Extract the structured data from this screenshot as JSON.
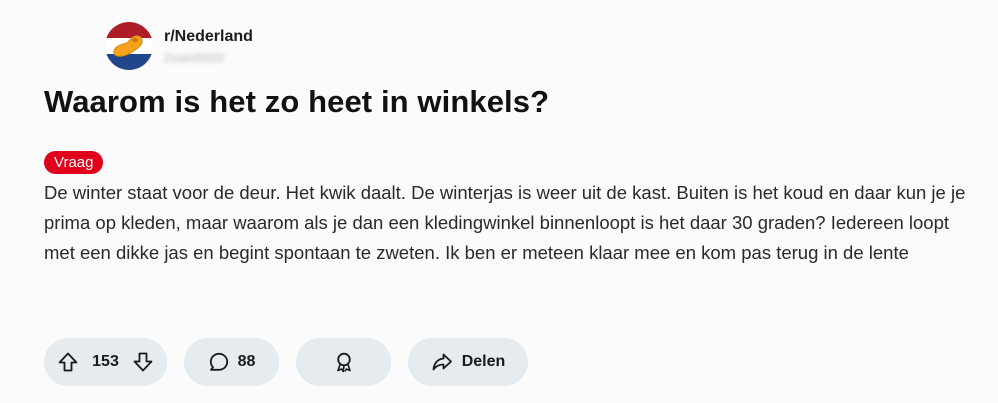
{
  "subreddit": {
    "name": "r/Nederland",
    "username": "Zealot5920",
    "flag_colors": {
      "top": "#ae1c28",
      "middle": "#ffffff",
      "bottom": "#21468b",
      "accent": "#f7a21b"
    }
  },
  "post": {
    "title": "Waarom is het zo heet in winkels?",
    "flair": {
      "label": "Vraag",
      "color": "#e0001b"
    },
    "body": "De winter staat voor de deur. Het kwik daalt. De winterjas is weer uit de kast. Buiten is het koud en daar kun je je prima op kleden, maar waarom als je dan een kledingwinkel binnenloopt is het daar 30 graden? Iedereen loopt met een dikke jas en begint spontaan te zweten. Ik ben er meteen klaar mee en kom pas terug in de lente"
  },
  "actions": {
    "upvote_icon": "arrow-up-icon",
    "downvote_icon": "arrow-down-icon",
    "score": "153",
    "comment_icon": "speech-bubble-icon",
    "comments": "88",
    "award_icon": "award-ribbon-icon",
    "share_icon": "share-arrow-icon",
    "share_label": "Delen"
  }
}
